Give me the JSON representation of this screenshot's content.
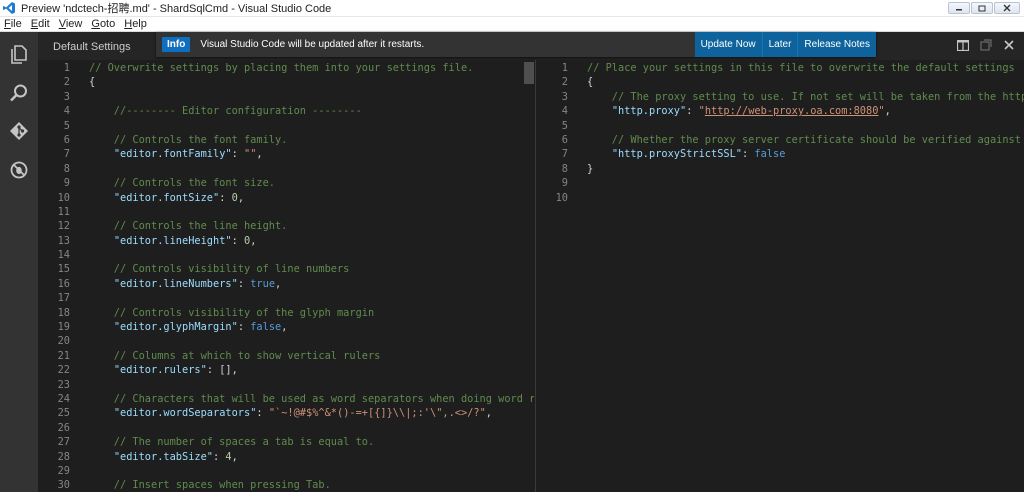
{
  "window": {
    "title": "Preview 'ndctech-招聘.md' - ShardSqlCmd - Visual Studio Code"
  },
  "menu": [
    {
      "mn": "F",
      "rest": "ile"
    },
    {
      "mn": "E",
      "rest": "dit"
    },
    {
      "mn": "V",
      "rest": "iew"
    },
    {
      "mn": "G",
      "rest": "oto"
    },
    {
      "mn": "H",
      "rest": "elp"
    }
  ],
  "activity_icons": [
    "explorer-icon",
    "search-icon",
    "git-icon",
    "debug-icon"
  ],
  "editor": {
    "tab_title": "Default Settings"
  },
  "notification": {
    "badge": "Info",
    "message": "Visual Studio Code will be updated after it restarts.",
    "actions": [
      "Update Now",
      "Later",
      "Release Notes"
    ]
  },
  "colors": {
    "activity_bar": "#333333",
    "editor_bg": "#1e1e1e",
    "comment": "#608b4e",
    "key": "#9cdcfe",
    "string": "#ce9178",
    "accent": "#0e639c"
  },
  "left_pane": {
    "lines": [
      {
        "n": "1",
        "parts": [
          {
            "t": "// Overwrite settings by placing them into your settings file.",
            "c": "comment"
          }
        ]
      },
      {
        "n": "2",
        "parts": [
          {
            "t": "{",
            "c": "punc"
          }
        ]
      },
      {
        "n": "3",
        "parts": []
      },
      {
        "n": "4",
        "parts": [
          {
            "t": "    //-------- Editor configuration --------",
            "c": "comment"
          }
        ]
      },
      {
        "n": "5",
        "parts": []
      },
      {
        "n": "6",
        "parts": [
          {
            "t": "    // Controls the font family.",
            "c": "comment"
          }
        ]
      },
      {
        "n": "7",
        "parts": [
          {
            "t": "    ",
            "c": "punc"
          },
          {
            "t": "\"editor.fontFamily\"",
            "c": "key"
          },
          {
            "t": ": ",
            "c": "punc"
          },
          {
            "t": "\"\"",
            "c": "str"
          },
          {
            "t": ",",
            "c": "punc"
          }
        ]
      },
      {
        "n": "8",
        "parts": []
      },
      {
        "n": "9",
        "parts": [
          {
            "t": "    // Controls the font size.",
            "c": "comment"
          }
        ]
      },
      {
        "n": "10",
        "parts": [
          {
            "t": "    ",
            "c": "punc"
          },
          {
            "t": "\"editor.fontSize\"",
            "c": "key"
          },
          {
            "t": ": ",
            "c": "punc"
          },
          {
            "t": "0",
            "c": "num"
          },
          {
            "t": ",",
            "c": "punc"
          }
        ]
      },
      {
        "n": "11",
        "parts": []
      },
      {
        "n": "12",
        "parts": [
          {
            "t": "    // Controls the line height.",
            "c": "comment"
          }
        ]
      },
      {
        "n": "13",
        "parts": [
          {
            "t": "    ",
            "c": "punc"
          },
          {
            "t": "\"editor.lineHeight\"",
            "c": "key"
          },
          {
            "t": ": ",
            "c": "punc"
          },
          {
            "t": "0",
            "c": "num"
          },
          {
            "t": ",",
            "c": "punc"
          }
        ]
      },
      {
        "n": "14",
        "parts": []
      },
      {
        "n": "15",
        "parts": [
          {
            "t": "    // Controls visibility of line numbers",
            "c": "comment"
          }
        ]
      },
      {
        "n": "16",
        "parts": [
          {
            "t": "    ",
            "c": "punc"
          },
          {
            "t": "\"editor.lineNumbers\"",
            "c": "key"
          },
          {
            "t": ": ",
            "c": "punc"
          },
          {
            "t": "true",
            "c": "bool"
          },
          {
            "t": ",",
            "c": "punc"
          }
        ]
      },
      {
        "n": "17",
        "parts": []
      },
      {
        "n": "18",
        "parts": [
          {
            "t": "    // Controls visibility of the glyph margin",
            "c": "comment"
          }
        ]
      },
      {
        "n": "19",
        "parts": [
          {
            "t": "    ",
            "c": "punc"
          },
          {
            "t": "\"editor.glyphMargin\"",
            "c": "key"
          },
          {
            "t": ": ",
            "c": "punc"
          },
          {
            "t": "false",
            "c": "bool"
          },
          {
            "t": ",",
            "c": "punc"
          }
        ]
      },
      {
        "n": "20",
        "parts": []
      },
      {
        "n": "21",
        "parts": [
          {
            "t": "    // Columns at which to show vertical rulers",
            "c": "comment"
          }
        ]
      },
      {
        "n": "22",
        "parts": [
          {
            "t": "    ",
            "c": "punc"
          },
          {
            "t": "\"editor.rulers\"",
            "c": "key"
          },
          {
            "t": ": [],",
            "c": "punc"
          }
        ]
      },
      {
        "n": "23",
        "parts": []
      },
      {
        "n": "24",
        "parts": [
          {
            "t": "    // Characters that will be used as word separators when doing word relate",
            "c": "comment"
          }
        ]
      },
      {
        "n": "25",
        "parts": [
          {
            "t": "    ",
            "c": "punc"
          },
          {
            "t": "\"editor.wordSeparators\"",
            "c": "key"
          },
          {
            "t": ": ",
            "c": "punc"
          },
          {
            "t": "\"`~!@#$%^&*()-=+[{]}\\\\|;:'\\\",.<>/?\"",
            "c": "str"
          },
          {
            "t": ",",
            "c": "punc"
          }
        ]
      },
      {
        "n": "26",
        "parts": []
      },
      {
        "n": "27",
        "parts": [
          {
            "t": "    // The number of spaces a tab is equal to.",
            "c": "comment"
          }
        ]
      },
      {
        "n": "28",
        "parts": [
          {
            "t": "    ",
            "c": "punc"
          },
          {
            "t": "\"editor.tabSize\"",
            "c": "key"
          },
          {
            "t": ": ",
            "c": "punc"
          },
          {
            "t": "4",
            "c": "num"
          },
          {
            "t": ",",
            "c": "punc"
          }
        ]
      },
      {
        "n": "29",
        "parts": []
      },
      {
        "n": "30",
        "parts": [
          {
            "t": "    // Insert spaces when pressing Tab.",
            "c": "comment"
          }
        ]
      }
    ]
  },
  "right_pane": {
    "lines": [
      {
        "n": "1",
        "parts": [
          {
            "t": "// Place your settings in this file to overwrite the default settings",
            "c": "comment"
          }
        ]
      },
      {
        "n": "2",
        "parts": [
          {
            "t": "{",
            "c": "punc"
          }
        ]
      },
      {
        "n": "3",
        "parts": [
          {
            "t": "    // The proxy setting to use. If not set will be taken from the http_proxy",
            "c": "comment"
          }
        ]
      },
      {
        "n": "4",
        "parts": [
          {
            "t": "    ",
            "c": "punc"
          },
          {
            "t": "\"http.proxy\"",
            "c": "key"
          },
          {
            "t": ": ",
            "c": "punc"
          },
          {
            "t": "\"",
            "c": "str"
          },
          {
            "t": "http://web-proxy.oa.com:8080",
            "c": "url"
          },
          {
            "t": "\"",
            "c": "str"
          },
          {
            "t": ",",
            "c": "punc"
          }
        ]
      },
      {
        "n": "5",
        "parts": []
      },
      {
        "n": "6",
        "parts": [
          {
            "t": "    // Whether the proxy server certificate should be verified against the l",
            "c": "comment"
          }
        ]
      },
      {
        "n": "7",
        "parts": [
          {
            "t": "    ",
            "c": "punc"
          },
          {
            "t": "\"http.proxyStrictSSL\"",
            "c": "key"
          },
          {
            "t": ": ",
            "c": "punc"
          },
          {
            "t": "false",
            "c": "bool"
          }
        ]
      },
      {
        "n": "8",
        "parts": [
          {
            "t": "}",
            "c": "punc"
          }
        ]
      },
      {
        "n": "9",
        "parts": []
      },
      {
        "n": "10",
        "parts": []
      }
    ]
  }
}
